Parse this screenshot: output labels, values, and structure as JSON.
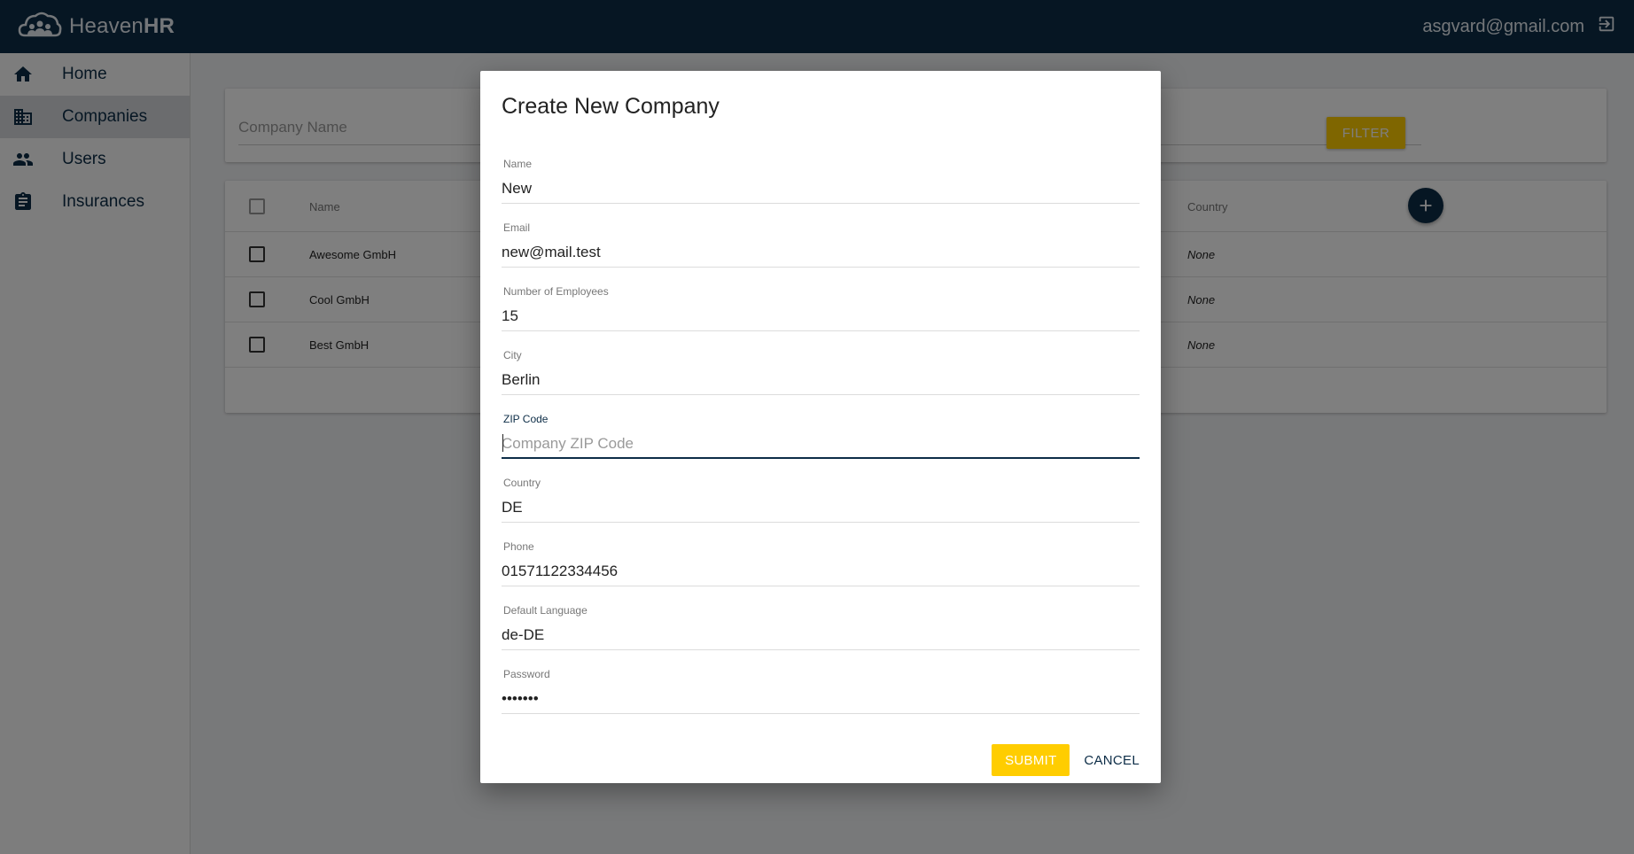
{
  "app": {
    "brand_name": "Heaven",
    "brand_bold": "HR",
    "user_email": "asgvard@gmail.com",
    "logout_icon": "logout-icon"
  },
  "sidebar": {
    "items": [
      {
        "label": "Home",
        "icon": "home-icon",
        "active": false
      },
      {
        "label": "Companies",
        "icon": "business-icon",
        "active": true
      },
      {
        "label": "Users",
        "icon": "people-icon",
        "active": false
      },
      {
        "label": "Insurances",
        "icon": "assignment-icon",
        "active": false
      }
    ]
  },
  "filter": {
    "placeholder": "Company Name",
    "button_label": "FILTER"
  },
  "table": {
    "columns": [
      "Name",
      "Country"
    ],
    "rows": [
      {
        "name": "Awesome GmbH",
        "country": "None"
      },
      {
        "name": "Cool GmbH",
        "country": "None"
      },
      {
        "name": "Best GmbH",
        "country": "None"
      }
    ]
  },
  "dialog": {
    "title": "Create New Company",
    "fields": [
      {
        "label": "Name",
        "value": "New",
        "placeholder": ""
      },
      {
        "label": "Email",
        "value": "new@mail.test",
        "placeholder": ""
      },
      {
        "label": "Number of Employees",
        "value": "15",
        "placeholder": ""
      },
      {
        "label": "City",
        "value": "Berlin",
        "placeholder": ""
      },
      {
        "label": "ZIP Code",
        "value": "",
        "placeholder": "Company ZIP Code"
      },
      {
        "label": "Country",
        "value": "DE",
        "placeholder": ""
      },
      {
        "label": "Phone",
        "value": "01571122334456",
        "placeholder": ""
      },
      {
        "label": "Default Language",
        "value": "de-DE",
        "placeholder": ""
      },
      {
        "label": "Password",
        "value": "•••••••",
        "placeholder": ""
      }
    ],
    "submit_label": "SUBMIT",
    "cancel_label": "CANCEL"
  },
  "colors": {
    "primary": "#0d2d47",
    "accent": "#ffcd00"
  }
}
